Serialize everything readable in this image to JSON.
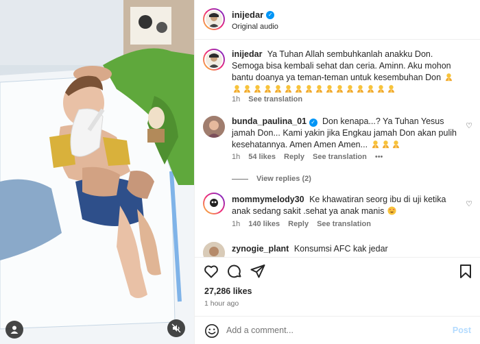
{
  "post": {
    "username": "inijedar",
    "subtitle": "Original audio",
    "more": "•••"
  },
  "comments": [
    {
      "username": "inijedar",
      "text": "Ya Tuhan Allah sembuhkanlah anakku Don. Semoga bisa kembali sehat dan ceria. Aminn. Aku mohon bantu doanya ya teman-teman untuk kesembuhan Don",
      "emoji_count": 17,
      "time": "1h",
      "translate": "See translation"
    },
    {
      "username": "bunda_paulina_01",
      "text": "Don kenapa...? Ya Tuhan Yesus jamah Don... Kami yakin jika Engkau jamah Don akan pulih kesehatannya. Amen Amen Amen...",
      "emoji_count": 3,
      "time": "1h",
      "likes": "54 likes",
      "reply": "Reply",
      "translate": "See translation",
      "more": "•••",
      "view_replies": "View replies (2)"
    },
    {
      "username": "mommymelody30",
      "text": "Ke khawatiran seorg ibu di uji ketika anak sedang sakit .sehat ya anak manis",
      "emoji": "heart-eyes",
      "time": "1h",
      "likes": "140 likes",
      "reply": "Reply",
      "translate": "See translation"
    },
    {
      "username": "zynogie_plant",
      "text": "Konsumsi AFC kak jedar"
    }
  ],
  "footer": {
    "likes": "27,286 likes",
    "time_ago": "1 hour ago",
    "comment_placeholder": "Add a comment...",
    "post_label": "Post"
  },
  "icons": {
    "like": "heart-icon",
    "comment": "comment-icon",
    "share": "share-icon",
    "save": "bookmark-icon",
    "emoji": "smile-icon",
    "media_user": "user-icon",
    "media_mute": "mute-icon"
  },
  "colors": {
    "verified": "#0095f6",
    "muted": "#737373",
    "post_disabled": "#b3dbff"
  }
}
